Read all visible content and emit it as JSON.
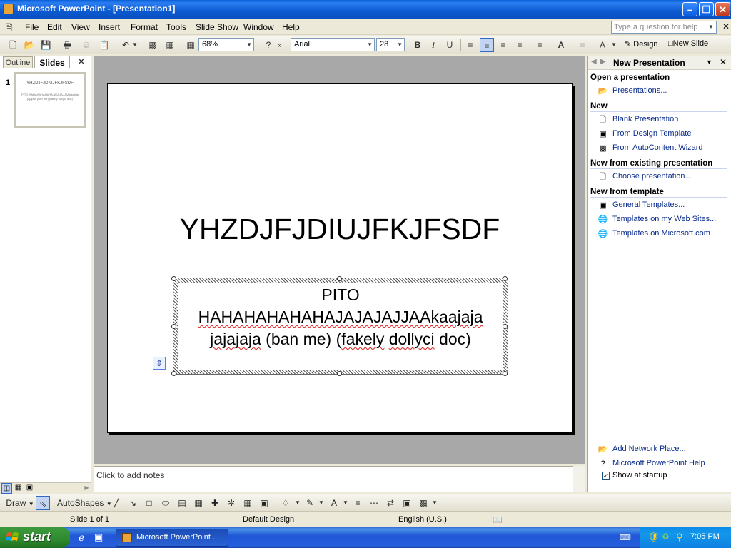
{
  "window": {
    "title": "Microsoft PowerPoint - [Presentation1]"
  },
  "menu": [
    "File",
    "Edit",
    "View",
    "Insert",
    "Format",
    "Tools",
    "Slide Show",
    "Window",
    "Help"
  ],
  "help_box": {
    "placeholder": "Type a question for help"
  },
  "toolbar": {
    "zoom": "68%",
    "font": "Arial",
    "font_size": "28",
    "design_label": "Design",
    "new_slide_label": "New Slide"
  },
  "left_pane": {
    "tab_outline": "Outline",
    "tab_slides": "Slides",
    "slide_number": "1",
    "thumb_title": "YHZDJFJDIUJFKJFSDF",
    "thumb_body": "PITO HAHAHAHAHAHAJAJAJAJJAAkaajaja jajajaja (ban me) (fakely dollyci doc)"
  },
  "slide": {
    "title": "YHZDJFJDIUJFKJFSDF",
    "body_line1": "PITO",
    "body_line2": "HAHAHAHAHAHAJAJAJAJJAAkaajaja",
    "body_line3_a": "jajajaja",
    "body_line3_b": " (ban me) (",
    "body_line3_c": "fakely",
    "body_line3_d": " ",
    "body_line3_e": "dollyci",
    "body_line3_f": " doc)"
  },
  "notes": {
    "placeholder": "Click to add notes"
  },
  "task_pane": {
    "title": "New Presentation",
    "sections": {
      "open": "Open a presentation",
      "new": "New",
      "existing": "New from existing presentation",
      "template": "New from template"
    },
    "links": {
      "presentations": "Presentations...",
      "blank": "Blank Presentation",
      "design_template": "From Design Template",
      "autocontent": "From AutoContent Wizard",
      "choose": "Choose presentation...",
      "general_templates": "General Templates...",
      "web_sites": "Templates on my Web Sites...",
      "microsoft_com": "Templates on Microsoft.com",
      "network_place": "Add Network Place...",
      "ppt_help": "Microsoft PowerPoint Help"
    },
    "show_at_startup": "Show at startup",
    "show_at_startup_checked": true
  },
  "drawing_toolbar": {
    "draw": "Draw",
    "autoshapes": "AutoShapes"
  },
  "status": {
    "slide": "Slide 1 of 1",
    "design": "Default Design",
    "language": "English (U.S.)"
  },
  "taskbar": {
    "start": "start",
    "task_ppt": "Microsoft PowerPoint ...",
    "clock": "7:05 PM"
  }
}
